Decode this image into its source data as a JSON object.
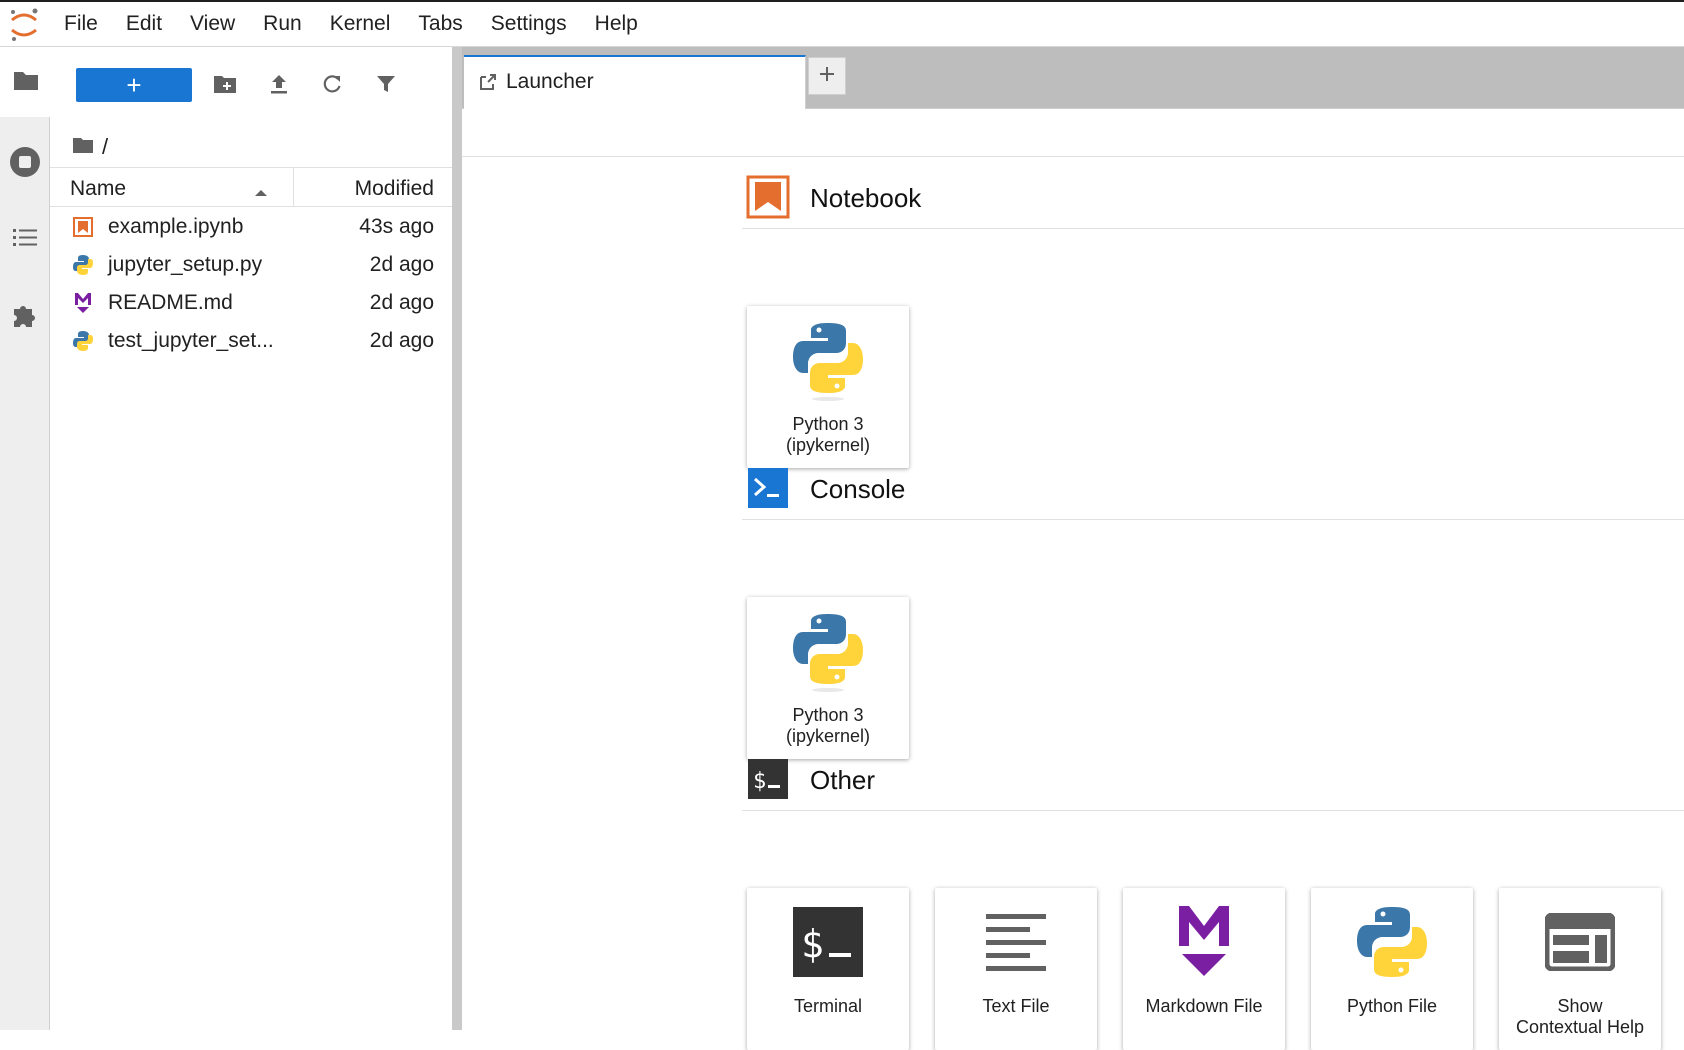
{
  "menubar": {
    "items": [
      "File",
      "Edit",
      "View",
      "Run",
      "Kernel",
      "Tabs",
      "Settings",
      "Help"
    ]
  },
  "activity_bar": {
    "items": [
      {
        "icon": "folder-icon"
      },
      {
        "icon": "running-icon"
      },
      {
        "icon": "toc-icon"
      },
      {
        "icon": "extension-icon"
      }
    ]
  },
  "file_browser": {
    "new_label": "+",
    "breadcrumb": "/",
    "columns": {
      "name": "Name",
      "modified": "Modified"
    },
    "files": [
      {
        "name": "example.ipynb",
        "modified": "43s ago",
        "icon": "notebook-icon"
      },
      {
        "name": "jupyter_setup.py",
        "modified": "2d ago",
        "icon": "python-icon"
      },
      {
        "name": "README.md",
        "modified": "2d ago",
        "icon": "markdown-icon"
      },
      {
        "name": "test_jupyter_set...",
        "modified": "2d ago",
        "icon": "python-icon"
      }
    ]
  },
  "tabs": [
    {
      "label": "Launcher",
      "icon": "launcher-icon"
    }
  ],
  "launcher": {
    "sections": {
      "notebook": {
        "title": "Notebook",
        "cards": [
          {
            "line1": "Python 3",
            "line2": "(ipykernel)"
          }
        ]
      },
      "console": {
        "title": "Console",
        "cards": [
          {
            "line1": "Python 3",
            "line2": "(ipykernel)"
          }
        ]
      },
      "other": {
        "title": "Other",
        "cards": [
          {
            "line1": "Terminal",
            "line2": ""
          },
          {
            "line1": "Text File",
            "line2": ""
          },
          {
            "line1": "Markdown File",
            "line2": ""
          },
          {
            "line1": "Python File",
            "line2": ""
          },
          {
            "line1": "Show",
            "line2": "Contextual Help"
          }
        ]
      }
    }
  },
  "colors": {
    "accent": "#1976d2",
    "notebook_orange": "#e46e2e",
    "markdown_purple": "#7b1fa2",
    "python_blue": "#3b77a8",
    "python_yellow": "#ffd43b",
    "icon_gray": "#616161"
  }
}
